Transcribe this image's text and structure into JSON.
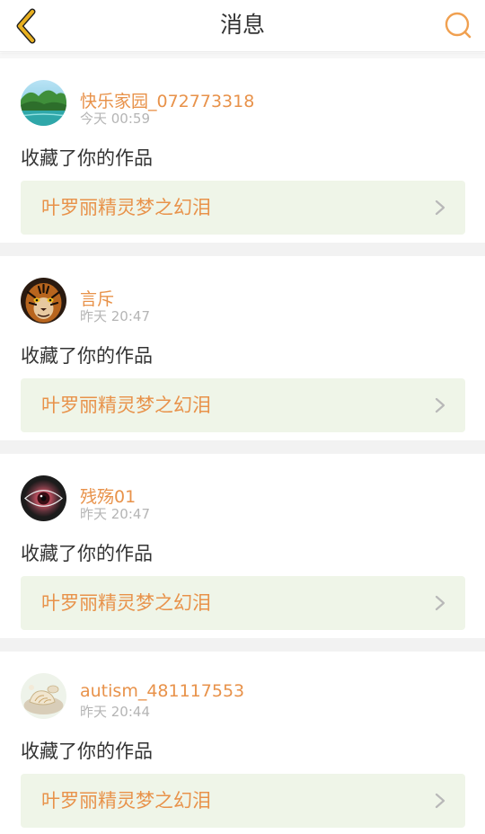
{
  "header": {
    "title": "消息",
    "back_icon": "chevron-left-icon",
    "search_icon": "search-icon",
    "back_color": "#e8b020",
    "search_color": "#f0a050"
  },
  "colors": {
    "accent": "#e8924a",
    "link_bg": "#eff5e8",
    "text": "#333333",
    "muted": "#b5b5b5"
  },
  "notifications": [
    {
      "username": "快乐家园_072773318",
      "time": "今天 00:59",
      "action": "收藏了你的作品",
      "work_title": "叶罗丽精灵梦之幻泪",
      "avatar": "landscape-avatar"
    },
    {
      "username": "言斥",
      "time": "昨天 20:47",
      "action": "收藏了你的作品",
      "work_title": "叶罗丽精灵梦之幻泪",
      "avatar": "tiger-avatar"
    },
    {
      "username": "残殇01",
      "time": "昨天 20:47",
      "action": "收藏了你的作品",
      "work_title": "叶罗丽精灵梦之幻泪",
      "avatar": "eye-avatar"
    },
    {
      "username": "autism_481117553",
      "time": "昨天 20:44",
      "action": "收藏了你的作品",
      "work_title": "叶罗丽精灵梦之幻泪",
      "avatar": "seashell-avatar"
    }
  ]
}
